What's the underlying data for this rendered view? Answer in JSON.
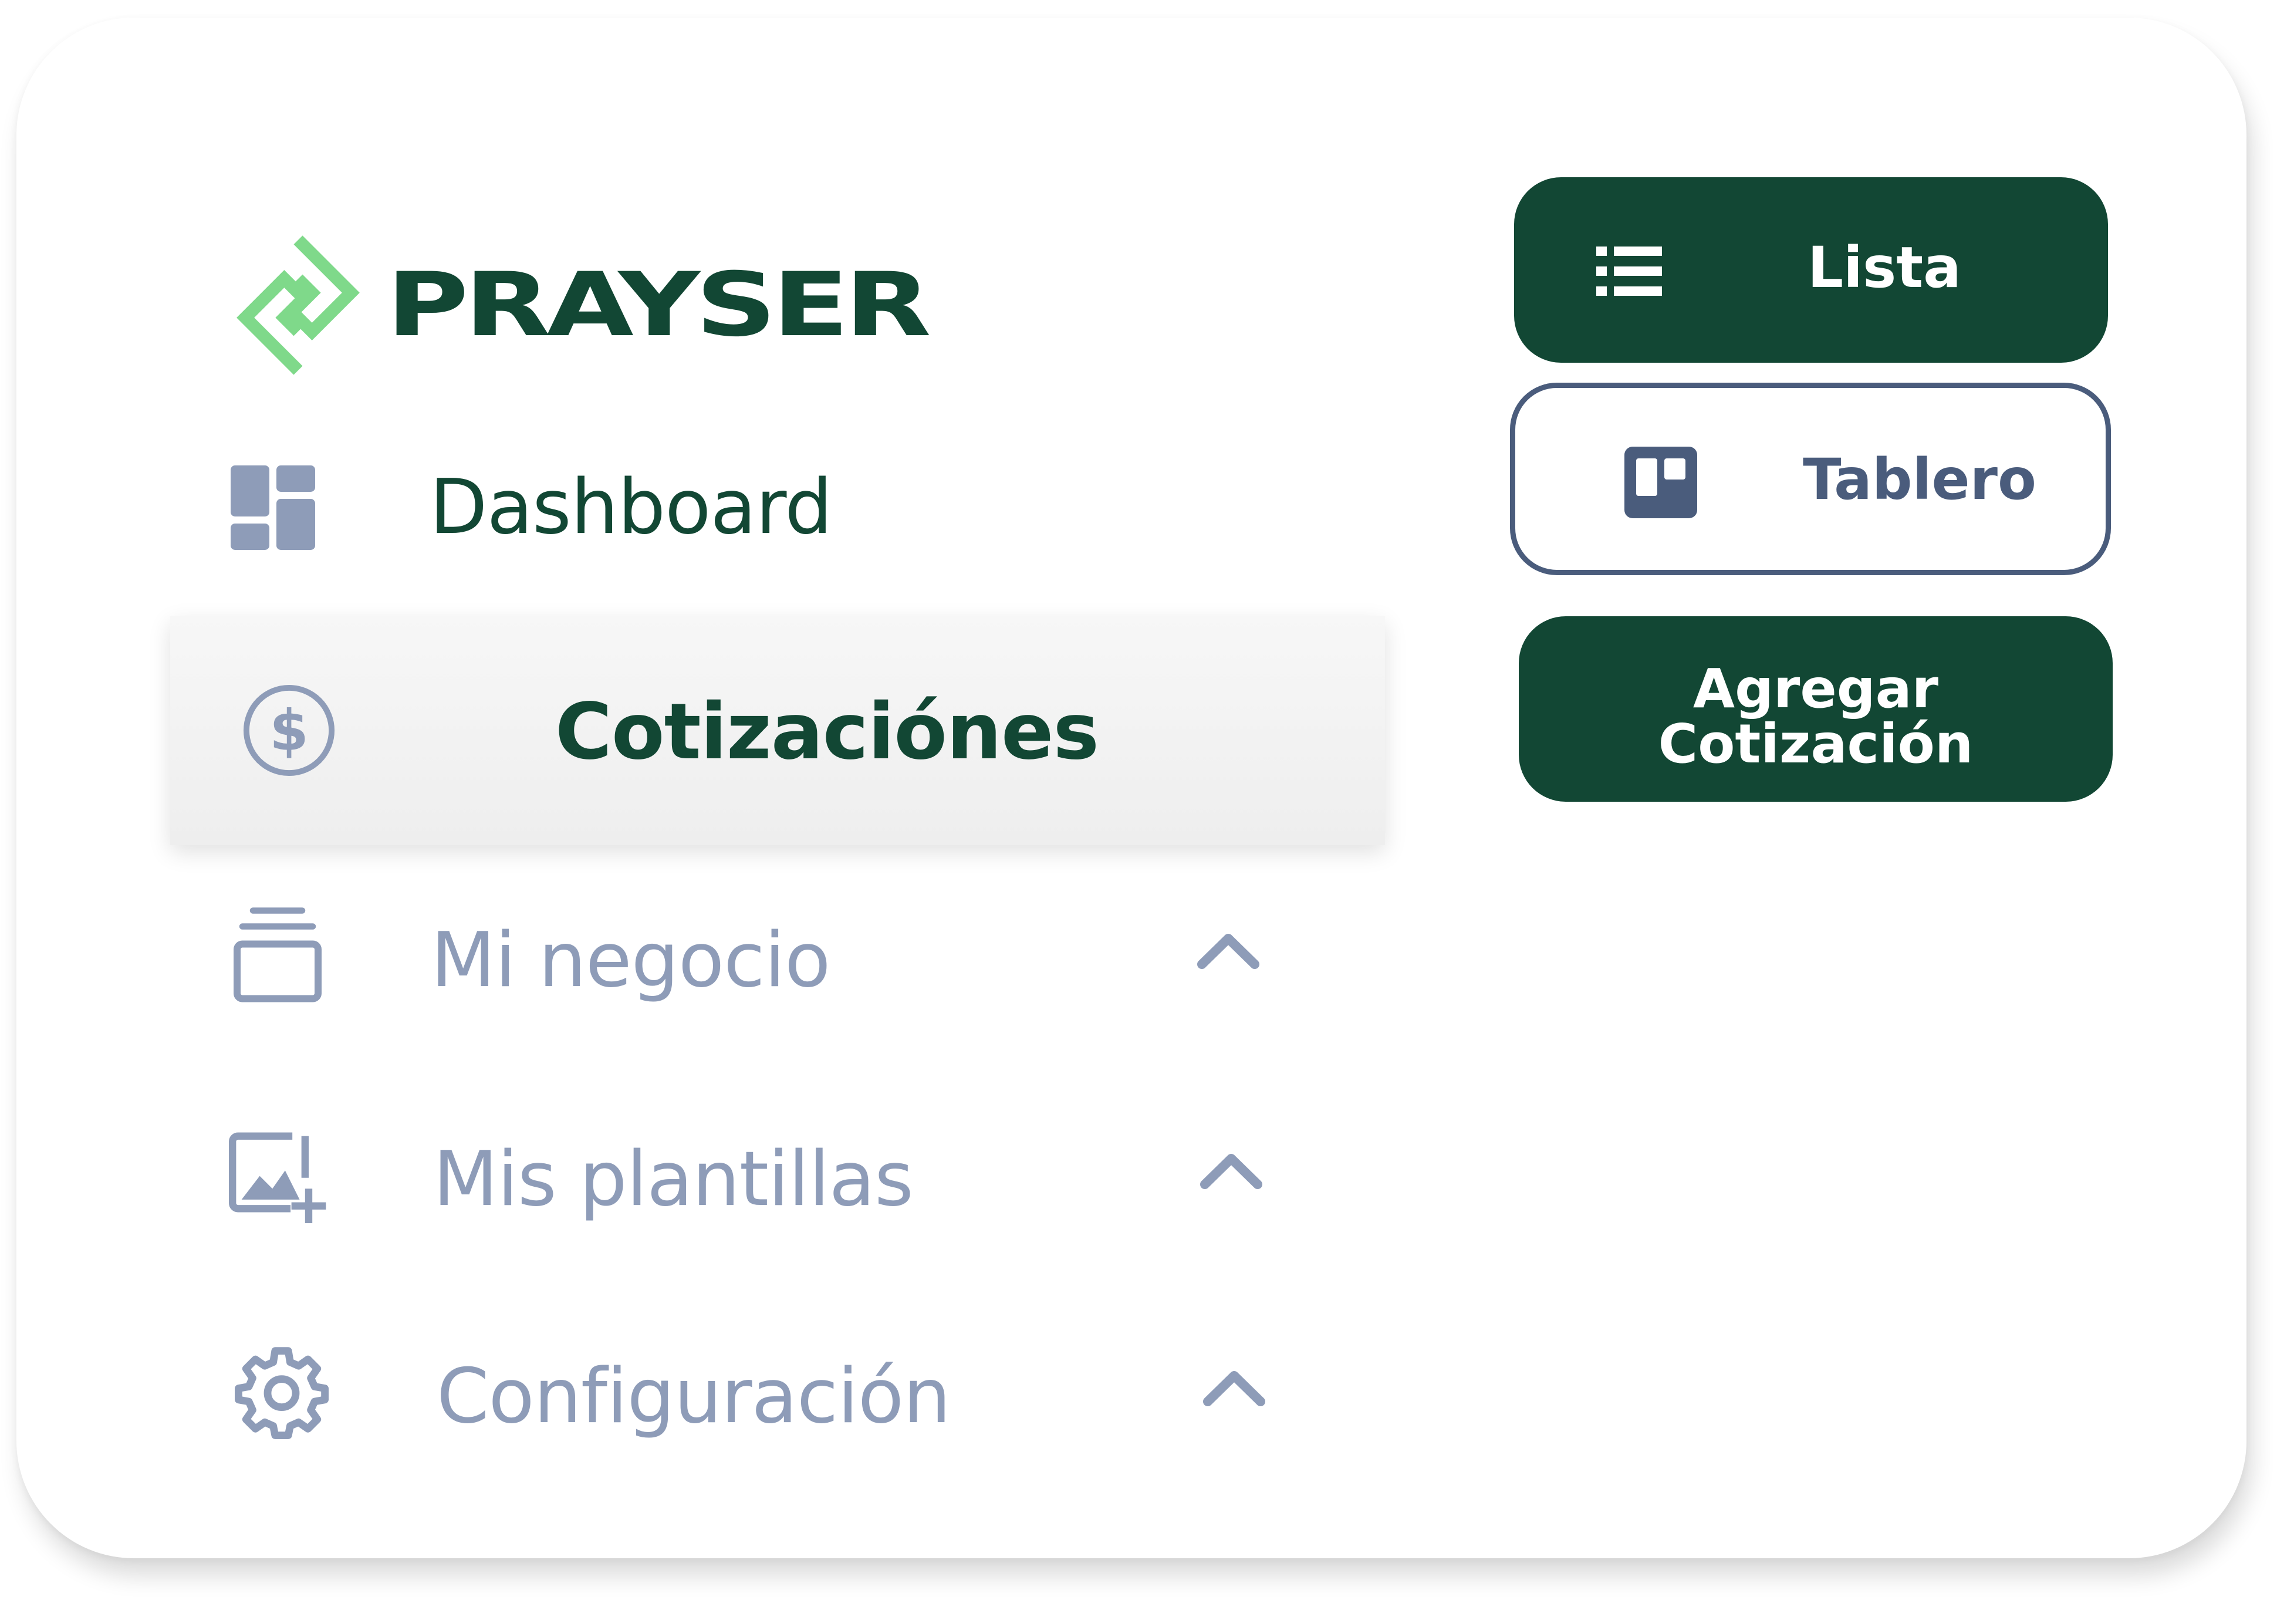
{
  "brand": {
    "name": "PRAYSER",
    "logo_color": "#124734",
    "mark_color": "#7fd98a"
  },
  "sidebar": {
    "items": [
      {
        "label": "Dashboard",
        "icon": "dashboard-grid-icon",
        "active": false
      },
      {
        "label": "Cotizaciónes",
        "icon": "dollar-circle-icon",
        "active": true
      },
      {
        "label": "Mi negocio",
        "icon": "layers-stack-icon",
        "expandable": true,
        "expanded": true
      },
      {
        "label": "Mis plantillas",
        "icon": "image-add-icon",
        "expandable": true,
        "expanded": true
      },
      {
        "label": "Configuración",
        "icon": "gear-icon",
        "expandable": true,
        "expanded": true
      }
    ]
  },
  "view_toggle": {
    "list_label": "Lista",
    "list_icon": "list-icon",
    "board_label": "Tablero",
    "board_icon": "board-icon",
    "selected": "Lista"
  },
  "actions": {
    "add_quote_line1": "Agregar",
    "add_quote_line2": "Cotización"
  },
  "colors": {
    "primary": "#124734",
    "muted": "#8e9cb8",
    "outline": "#4a5c7c",
    "active_bg": "#f2f2f2"
  }
}
